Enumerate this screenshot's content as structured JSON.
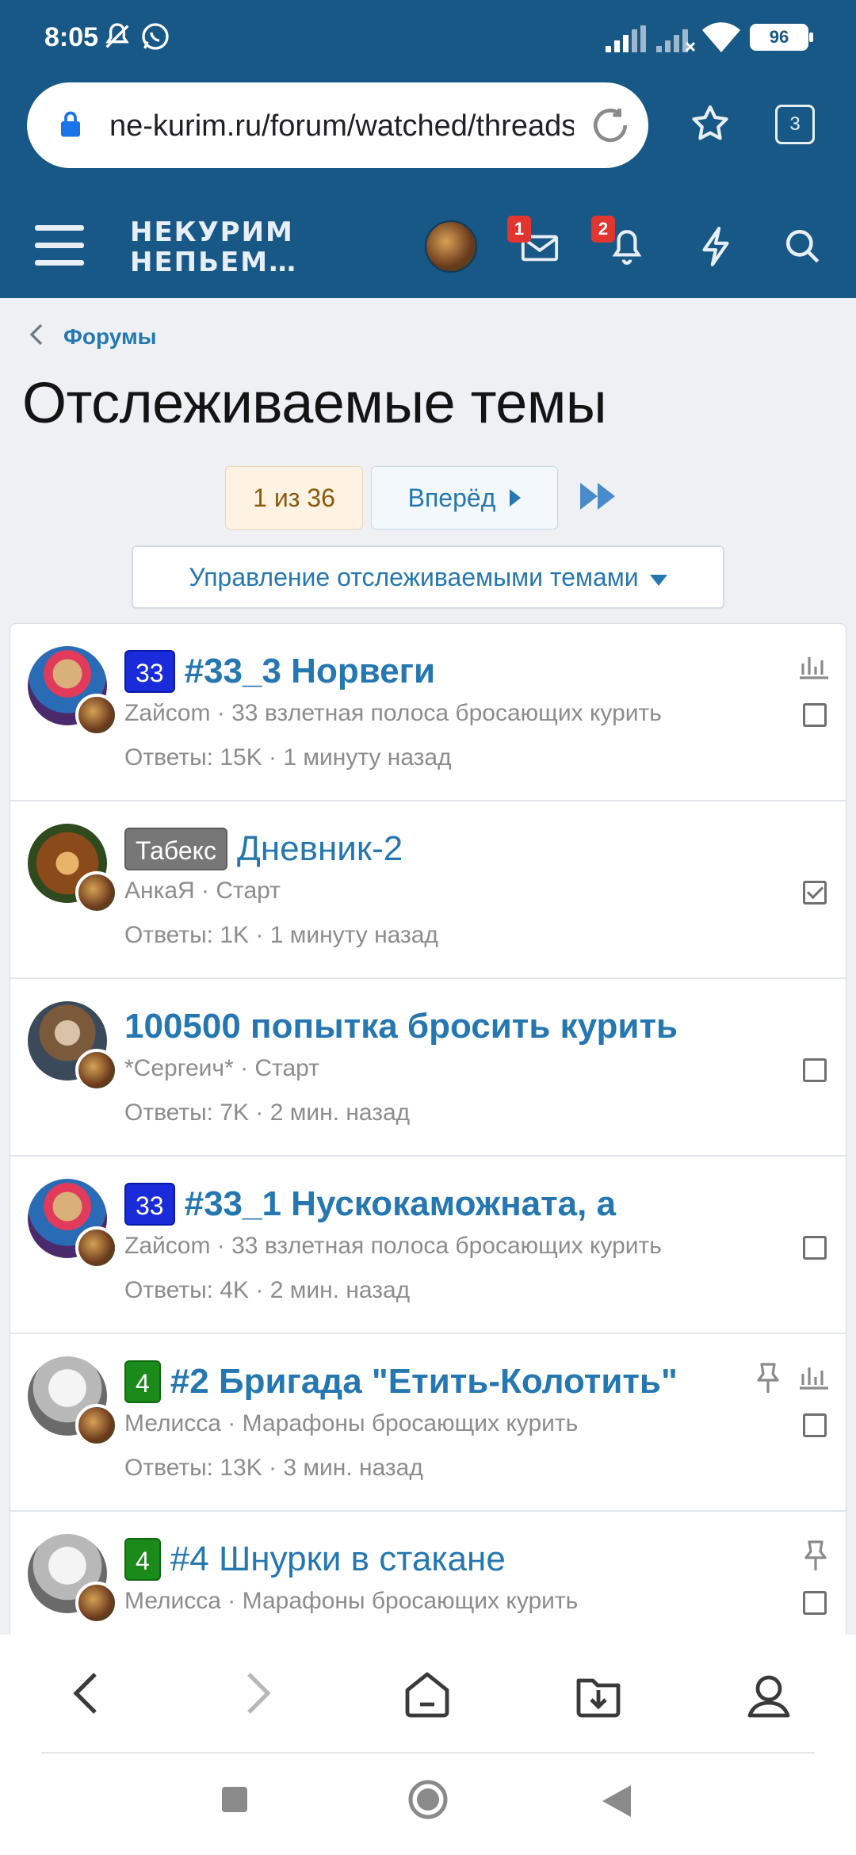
{
  "status_bar": {
    "time": "8:05",
    "battery": "96",
    "icons": [
      "mute-bell-icon",
      "whatsapp-icon",
      "signal-icon",
      "signal-off-icon",
      "wifi-icon",
      "battery-icon"
    ]
  },
  "browser": {
    "url": "ne-kurim.ru/forum/watched/threads",
    "tab_count": "3"
  },
  "site": {
    "logo_line1": "НЕКУРИМ",
    "logo_line2": "НЕПЬЕМ…",
    "inbox_count": "1",
    "alerts_count": "2",
    "accent_color": "#185886",
    "link_color": "#2577b1"
  },
  "breadcrumb": {
    "label": "Форумы"
  },
  "page": {
    "title": "Отслеживаемые темы"
  },
  "pagination": {
    "current": "1 из 36",
    "next_label": "Вперёд"
  },
  "manage": {
    "label": "Управление отслеживаемыми темами"
  },
  "threads": [
    {
      "prefix": "33",
      "title": "#33_3 Норвеги",
      "author": "Zaйcom",
      "forum": "33 взлетная полоса бросающих курить",
      "stats": "Ответы: 15K · 1 минуту назад",
      "unread": true,
      "checked": false,
      "sticky": false,
      "poll": true
    },
    {
      "prefix": "Табекс",
      "title": "Дневник-2",
      "author": "АнкаЯ",
      "forum": "Старт",
      "stats": "Ответы: 1K · 1 минуту назад",
      "unread": false,
      "checked": true,
      "sticky": false,
      "poll": false
    },
    {
      "prefix": "",
      "title": "100500 попытка бросить курить",
      "author": "*Сергеич*",
      "forum": "Старт",
      "stats": "Ответы: 7K · 2 мин. назад",
      "unread": true,
      "checked": false,
      "sticky": false,
      "poll": false
    },
    {
      "prefix": "33",
      "title": "#33_1 Нускокаможната, а",
      "author": "Zaйcom",
      "forum": "33 взлетная полоса бросающих курить",
      "stats": "Ответы: 4K · 2 мин. назад",
      "unread": true,
      "checked": false,
      "sticky": false,
      "poll": false
    },
    {
      "prefix": "4",
      "title": "#2 Бригада \"Етить-Колотить\"",
      "author": "Мелисса",
      "forum": "Марафоны бросающих курить",
      "stats": "Ответы: 13K · 3 мин. назад",
      "unread": true,
      "checked": false,
      "sticky": true,
      "poll": true
    },
    {
      "prefix": "4",
      "title": "#4 Шнурки в стакане",
      "author": "Мелисса",
      "forum": "Марафоны бросающих курить",
      "stats": "",
      "unread": false,
      "checked": false,
      "sticky": true,
      "poll": false
    }
  ],
  "bottom_nav": [
    "back-icon",
    "forward-icon",
    "home-icon",
    "downloads-icon",
    "profile-icon"
  ]
}
